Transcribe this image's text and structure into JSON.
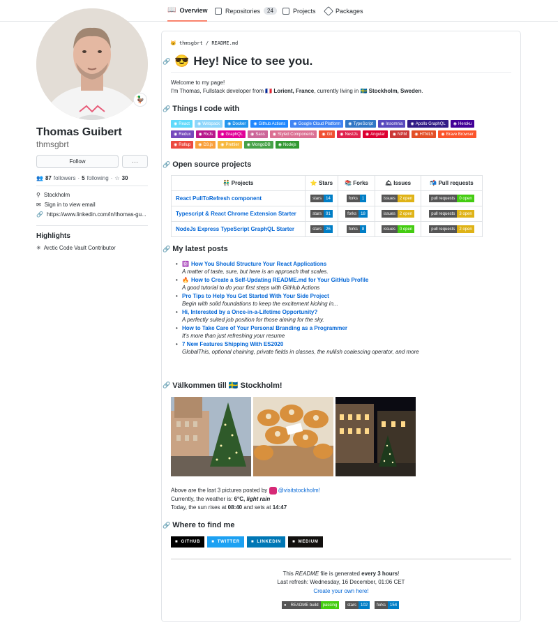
{
  "tabs": [
    {
      "label": "Overview"
    },
    {
      "label": "Repositories",
      "count": "24"
    },
    {
      "label": "Projects"
    },
    {
      "label": "Packages"
    }
  ],
  "profile": {
    "name": "Thomas Guibert",
    "login": "thmsgbrt",
    "follow": "Follow",
    "more": "···",
    "status_emoji": "🦆",
    "followers": "87",
    "followers_label": "followers",
    "following": "5",
    "following_label": "following",
    "stars": "30",
    "location": "Stockholm",
    "email": "Sign in to view email",
    "website": "https://www.linkedin.com/in/thomas-gu..."
  },
  "highlights": {
    "title": "Highlights",
    "item": "Arctic Code Vault Contributor"
  },
  "readme": {
    "owner": "thmsgbrt",
    "file": "README.md",
    "title": "Hey! Nice to see you.",
    "title_emoji": "😎",
    "welcome": "Welcome to my page!",
    "intro_pre": "I'm Thomas, Fullstack developer from ",
    "intro_place": "Lorient, France",
    "intro_mid": ", currently living in ",
    "intro_city": "Stockholm, Sweden",
    "intro_end": "."
  },
  "sections": {
    "code": "Things I code with",
    "oss": "Open source projects",
    "posts": "My latest posts",
    "stockholm": "Välkommen till 🇸🇪 Stockholm!",
    "find": "Where to find me"
  },
  "tech": [
    {
      "label": "React",
      "color": "#61dafb"
    },
    {
      "label": "Webpack",
      "color": "#8ed6fb"
    },
    {
      "label": "Docker",
      "color": "#2496ed"
    },
    {
      "label": "Github Actions",
      "color": "#2088ff"
    },
    {
      "label": "Google Cloud Platform",
      "color": "#4285f4"
    },
    {
      "label": "TypeScript",
      "color": "#3178c6"
    },
    {
      "label": "Insomnia",
      "color": "#5849be"
    },
    {
      "label": "Apollo GraphQL",
      "color": "#311c87"
    },
    {
      "label": "Heroku",
      "color": "#430098"
    },
    {
      "label": "Redux",
      "color": "#764abc"
    },
    {
      "label": "RxJs",
      "color": "#b7178c"
    },
    {
      "label": "GraphQL",
      "color": "#e10098"
    },
    {
      "label": "Sass",
      "color": "#cc6699"
    },
    {
      "label": "Styled Components",
      "color": "#db7093"
    },
    {
      "label": "Git",
      "color": "#f05032"
    },
    {
      "label": "NestJs",
      "color": "#e0234e"
    },
    {
      "label": "Angular",
      "color": "#dd0031"
    },
    {
      "label": "NPM",
      "color": "#cb3837"
    },
    {
      "label": "HTML5",
      "color": "#e34f26"
    },
    {
      "label": "Brave Browser",
      "color": "#fb542b"
    },
    {
      "label": "Rollup",
      "color": "#ec4a3f"
    },
    {
      "label": "D3.js",
      "color": "#f9a03c"
    },
    {
      "label": "Prettier",
      "color": "#f7b93e"
    },
    {
      "label": "MongoDB",
      "color": "#47a248"
    },
    {
      "label": "Nodejs",
      "color": "#339933"
    }
  ],
  "projects": {
    "headers": [
      "👬 Projects",
      "⭐ Stars",
      "📚 Forks",
      "🛎 Issues",
      "📬 Pull requests"
    ],
    "rows": [
      {
        "name": "React PullToRefresh component",
        "stars": "14",
        "forks": "1",
        "issues": "2 open",
        "issues_color": "#dfb317",
        "prs": "0 open",
        "prs_color": "#4c1"
      },
      {
        "name": "Typescript & React Chrome Extension Starter",
        "stars": "91",
        "forks": "18",
        "issues": "2 open",
        "issues_color": "#dfb317",
        "prs": "3 open",
        "prs_color": "#dfb317"
      },
      {
        "name": "NodeJs Express TypeScript GraphQL Starter",
        "stars": "26",
        "forks": "8",
        "issues": "0 open",
        "issues_color": "#4c1",
        "prs": "2 open",
        "prs_color": "#dfb317"
      }
    ],
    "stars_label": "stars",
    "forks_label": "forks",
    "issues_label": "issues",
    "prs_label": "pull requests"
  },
  "posts": [
    {
      "icon": "⚛️",
      "title": "How You Should Structure Your React Applications",
      "desc": "A matter of taste, sure, but here is an approach that scales."
    },
    {
      "icon": "🔥",
      "title": "How to Create a Self-Updating README.md for Your GitHub Profile",
      "desc": "A good tutorial to do your first steps with GitHub Actions"
    },
    {
      "icon": "",
      "title": "Pro Tips to Help You Get Started With Your Side Project",
      "desc": "Begin with solid foundations to keep the excitement kicking in..."
    },
    {
      "icon": "",
      "title": "Hi, Interested by a Once-in-a-Lifetime Opportunity?",
      "desc": "A perfectly suited job position for those aiming for the sky."
    },
    {
      "icon": "",
      "title": "How to Take Care of Your Personal Branding as a Programmer",
      "desc": "It's more than just refreshing your resume"
    },
    {
      "icon": "",
      "title": "7 New Features Shipping With ES2020",
      "desc": "GlobalThis, optional chaining, private fields in classes, the nullish coalescing operator, and more"
    }
  ],
  "weather": {
    "posted": "Above are the last 3 pictures posted by ",
    "insta": "@visitstockholm!",
    "cur": "Currently, the weather is: ",
    "temp": "6°C, ",
    "cond": "light rain",
    "sun_pre": "Today, the sun rises at ",
    "rise": "08:40",
    "sun_mid": " and sets at ",
    "set": "14:47"
  },
  "social": [
    {
      "label": "GITHUB",
      "color": "#000000"
    },
    {
      "label": "TWITTER",
      "color": "#1da1f2"
    },
    {
      "label": "LINKEDIN",
      "color": "#0077b5"
    },
    {
      "label": "MEDIUM",
      "color": "#12100e"
    }
  ],
  "footer": {
    "gen_pre": "This ",
    "gen_readme": "README",
    "gen_mid": " file is generated ",
    "gen_every": "every 3 hours",
    "gen_end": "!",
    "refresh": "Last refresh: Wednesday, 16 December, 01:06 CET",
    "create": "Create your own here!",
    "build_l": "README build",
    "build_r": "passing",
    "stars_l": "stars",
    "stars_r": "102",
    "forks_l": "forks",
    "forks_r": "154"
  }
}
